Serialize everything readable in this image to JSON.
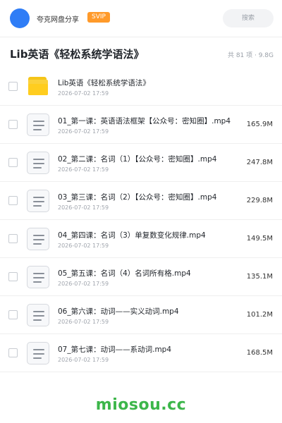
{
  "header": {
    "brand": "夸克网盘分享",
    "badge": "SVIP",
    "search_label": "搜索"
  },
  "share": {
    "title": "Lib英语《轻松系统学语法》",
    "meta": "共 81 项 · 9.8G"
  },
  "items": [
    {
      "type": "folder",
      "name": "Lib英语《轻松系统学语法》",
      "date": "2026-07-02 17:59",
      "size": ""
    },
    {
      "type": "file",
      "name": "01_第一课：英语语法框架【公众号：密知圈】.mp4",
      "date": "2026-07-02 17:59",
      "size": "165.9M"
    },
    {
      "type": "file",
      "name": "02_第二课：名词（1）【公众号：密知圈】.mp4",
      "date": "2026-07-02 17:59",
      "size": "247.8M"
    },
    {
      "type": "file",
      "name": "03_第三课：名词（2）【公众号：密知圈】.mp4",
      "date": "2026-07-02 17:59",
      "size": "229.8M"
    },
    {
      "type": "file",
      "name": "04_第四课：名词（3）单复数变化规律.mp4",
      "date": "2026-07-02 17:59",
      "size": "149.5M"
    },
    {
      "type": "file",
      "name": "05_第五课：名词（4）名词所有格.mp4",
      "date": "2026-07-02 17:59",
      "size": "135.1M"
    },
    {
      "type": "file",
      "name": "06_第六课：动词——实义动词.mp4",
      "date": "2026-07-02 17:59",
      "size": "101.2M"
    },
    {
      "type": "file",
      "name": "07_第七课：动词——系动词.mp4",
      "date": "2026-07-02 17:59",
      "size": "168.5M"
    }
  ],
  "watermark": "miosou.cc",
  "colors": {
    "accent": "#2f7df6",
    "badge": "#ff9a2a",
    "folder": "#fbd13b",
    "watermark": "#3cb64a"
  }
}
